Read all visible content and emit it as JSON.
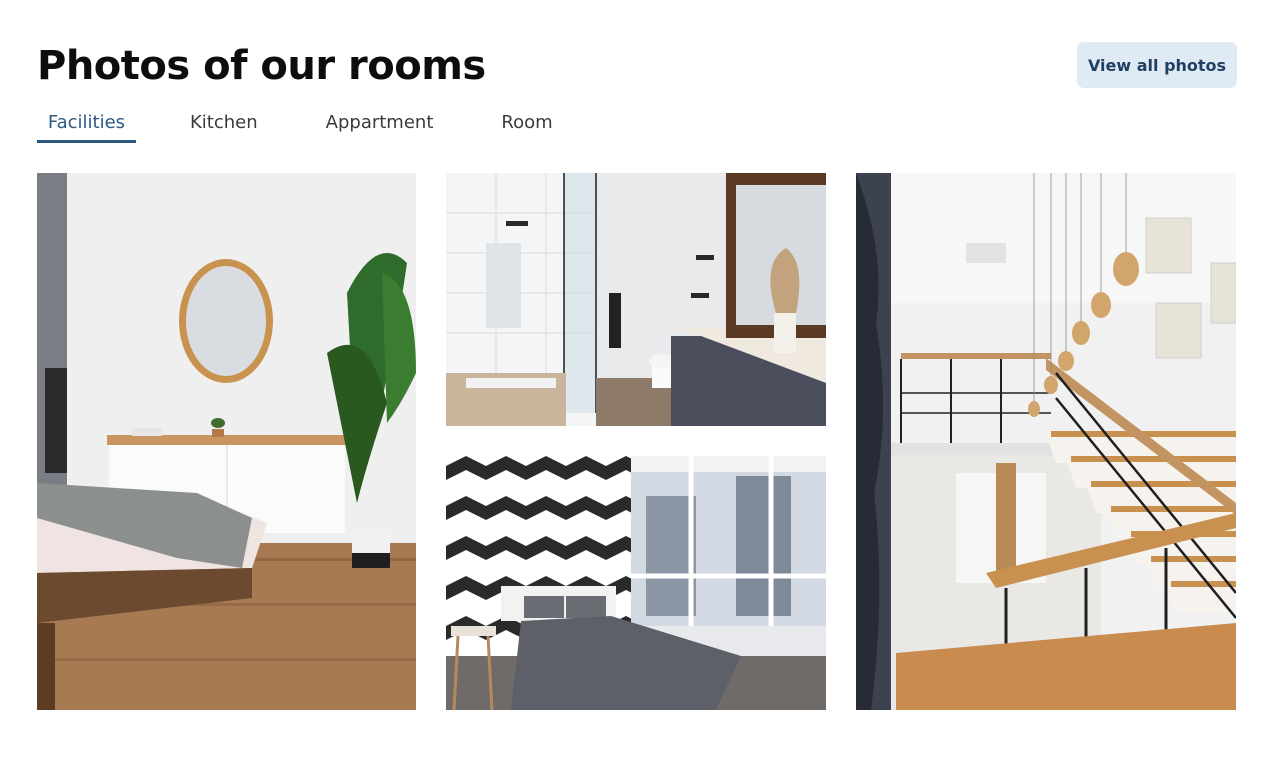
{
  "header": {
    "title": "Photos of our rooms",
    "view_all_label": "View all photos"
  },
  "tabs": [
    {
      "label": "Facilities",
      "active": true
    },
    {
      "label": "Kitchen",
      "active": false
    },
    {
      "label": "Appartment",
      "active": false
    },
    {
      "label": "Room",
      "active": false
    }
  ],
  "colors": {
    "accent": "#2a5680",
    "button_bg": "#dfeaf5",
    "button_text": "#1f3f63"
  }
}
